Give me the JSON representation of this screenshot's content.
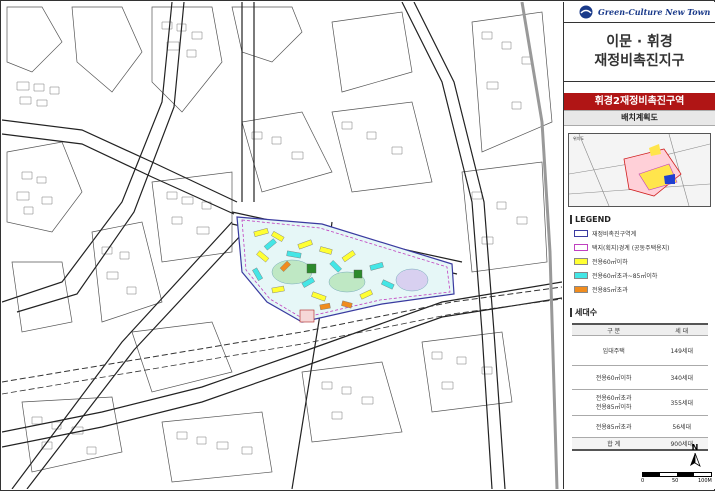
{
  "header": {
    "brand": "Green-Culture New Town",
    "title_line1": "이문 · 휘경",
    "title_line2": "재정비촉진지구"
  },
  "zone_name": "휘경2재정비촉진구역",
  "plan_label": "배치계획도",
  "keymap_label": "위치도",
  "legend": {
    "heading": "LEGEND",
    "items": [
      {
        "label": "재정비촉진구역계",
        "color": "#3a3aa0"
      },
      {
        "label": "택지(획지)경계 (공동주택용지)",
        "color": "#c040c0"
      },
      {
        "label": "전용60㎡이하",
        "color": "#ffff33"
      },
      {
        "label": "전용60㎡초과~85㎡이하",
        "color": "#44e6e6"
      },
      {
        "label": "전용85㎡초과",
        "color": "#f08c1e"
      }
    ]
  },
  "households": {
    "heading": "세대수",
    "col1": "구 분",
    "col2": "세 대",
    "rows": [
      {
        "label": "임대주택",
        "value": "149세대"
      },
      {
        "label": "전용60㎡이하",
        "value": "340세대"
      },
      {
        "label": "전용60㎡초과\n전용85㎡이하",
        "value": "355세대"
      },
      {
        "label": "전용85㎡초과",
        "value": "56세대"
      }
    ],
    "total_label": "합 계",
    "total_value": "900세대"
  },
  "north_label": "N",
  "scale": {
    "ticks": [
      "0",
      "50",
      "100M"
    ]
  }
}
